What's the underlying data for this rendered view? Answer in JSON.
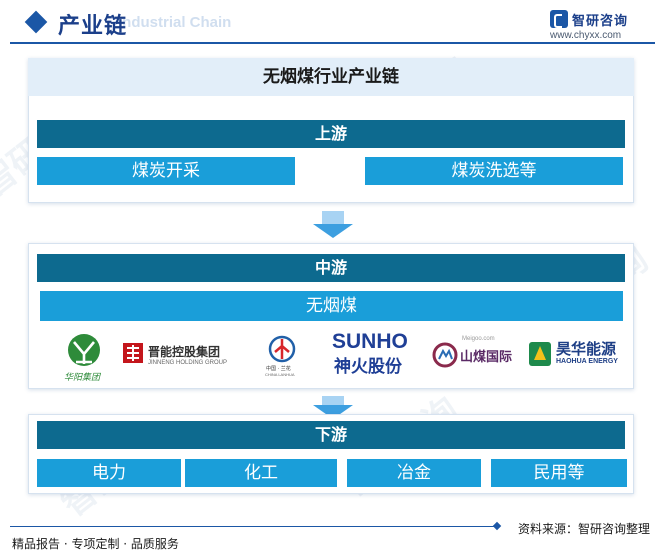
{
  "header": {
    "title": "产业链",
    "subtitle_en": "Industrial Chain",
    "brand_name": "智研咨询",
    "brand_url": "www.chyxx.com"
  },
  "diagram_title": "无烟煤行业产业链",
  "upstream": {
    "label": "上游",
    "items": [
      "煤炭开采",
      "煤炭洗选等"
    ]
  },
  "midstream": {
    "label": "中游",
    "product": "无烟煤",
    "companies": [
      {
        "name": "华阳集团",
        "mark": "华阳集团"
      },
      {
        "name": "晋能控股集团",
        "mark": "晋能控股集团",
        "sub": "JINNENG HOLDING GROUP"
      },
      {
        "name": "中国兰花",
        "mark": "中国 · 兰花",
        "sub": "CHINA LANHUA"
      },
      {
        "name": "神火股份",
        "mark": "SUNHO",
        "sub": "神火股份"
      },
      {
        "name": "山煤国际",
        "mark": "山煤国际",
        "sub": "Meigoo.com"
      },
      {
        "name": "昊华能源",
        "mark": "昊华能源",
        "sub": "HAOHUA ENERGY"
      }
    ]
  },
  "downstream": {
    "label": "下游",
    "items": [
      "电力",
      "化工",
      "冶金",
      "民用等"
    ]
  },
  "footer": {
    "source": "资料来源：智研咨询整理",
    "slogan": "精品报告 · 专项定制 · 品质服务"
  },
  "colors": {
    "primary": "#1b57a6",
    "bar": "#0d6a8f",
    "box": "#1a9ed9",
    "caption_bg": "#e2eef9"
  },
  "watermark": "智研咨询"
}
